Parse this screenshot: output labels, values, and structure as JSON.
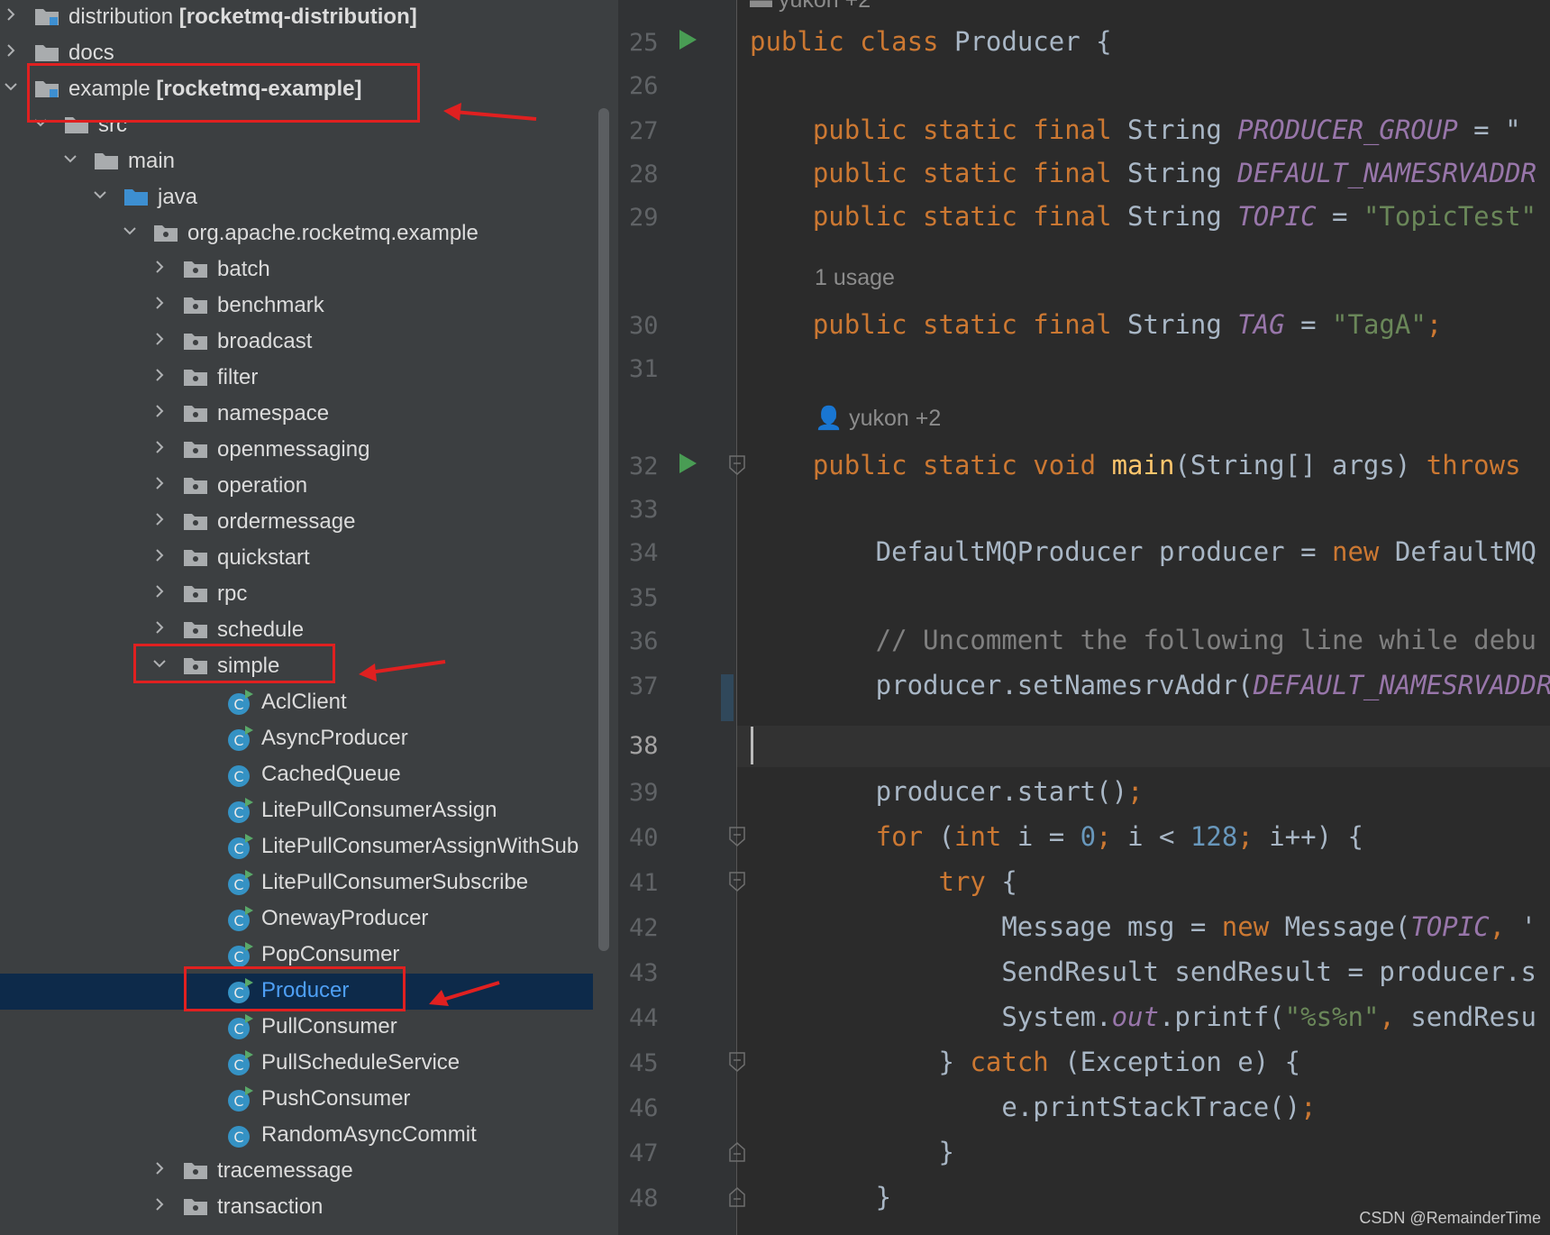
{
  "project_tree": {
    "items": [
      {
        "label": "distribution ",
        "module": "[rocketmq-distribution]",
        "type": "module",
        "expanded": false
      },
      {
        "label": "docs",
        "module": "",
        "type": "folder",
        "expanded": false
      },
      {
        "label": "example ",
        "module": "[rocketmq-example]",
        "type": "module",
        "expanded": true
      },
      {
        "label": "src",
        "module": "",
        "type": "folder",
        "expanded": true
      },
      {
        "label": "main",
        "module": "",
        "type": "folder",
        "expanded": true
      },
      {
        "label": "java",
        "module": "",
        "type": "source-folder",
        "expanded": true
      },
      {
        "label": "org.apache.rocketmq.example",
        "module": "",
        "type": "package",
        "expanded": true
      },
      {
        "label": "batch",
        "module": "",
        "type": "package",
        "expanded": false
      },
      {
        "label": "benchmark",
        "module": "",
        "type": "package",
        "expanded": false
      },
      {
        "label": "broadcast",
        "module": "",
        "type": "package",
        "expanded": false
      },
      {
        "label": "filter",
        "module": "",
        "type": "package",
        "expanded": false
      },
      {
        "label": "namespace",
        "module": "",
        "type": "package",
        "expanded": false
      },
      {
        "label": "openmessaging",
        "module": "",
        "type": "package",
        "expanded": false
      },
      {
        "label": "operation",
        "module": "",
        "type": "package",
        "expanded": false
      },
      {
        "label": "ordermessage",
        "module": "",
        "type": "package",
        "expanded": false
      },
      {
        "label": "quickstart",
        "module": "",
        "type": "package",
        "expanded": false
      },
      {
        "label": "rpc",
        "module": "",
        "type": "package",
        "expanded": false
      },
      {
        "label": "schedule",
        "module": "",
        "type": "package",
        "expanded": false
      },
      {
        "label": "simple",
        "module": "",
        "type": "package",
        "expanded": true
      },
      {
        "label": "AclClient",
        "module": "",
        "type": "class-runnable"
      },
      {
        "label": "AsyncProducer",
        "module": "",
        "type": "class-runnable"
      },
      {
        "label": "CachedQueue",
        "module": "",
        "type": "class"
      },
      {
        "label": "LitePullConsumerAssign",
        "module": "",
        "type": "class-runnable"
      },
      {
        "label": "LitePullConsumerAssignWithSub",
        "module": "",
        "type": "class-runnable"
      },
      {
        "label": "LitePullConsumerSubscribe",
        "module": "",
        "type": "class-runnable"
      },
      {
        "label": "OnewayProducer",
        "module": "",
        "type": "class-runnable"
      },
      {
        "label": "PopConsumer",
        "module": "",
        "type": "class-runnable"
      },
      {
        "label": "Producer",
        "module": "",
        "type": "class-runnable",
        "selected": true
      },
      {
        "label": "PullConsumer",
        "module": "",
        "type": "class-runnable"
      },
      {
        "label": "PullScheduleService",
        "module": "",
        "type": "class-runnable"
      },
      {
        "label": "PushConsumer",
        "module": "",
        "type": "class-runnable"
      },
      {
        "label": "RandomAsyncCommit",
        "module": "",
        "type": "class"
      },
      {
        "label": "tracemessage",
        "module": "",
        "type": "package",
        "expanded": false
      },
      {
        "label": "transaction",
        "module": "",
        "type": "package",
        "expanded": false
      }
    ]
  },
  "editor": {
    "top_hint": "yukon +2",
    "current_line": "38",
    "usage_hint": "1 usage",
    "author_hint": "yukon +2",
    "lines": [
      {
        "n": "25",
        "tokens": [
          [
            "kw",
            "public class "
          ],
          [
            "",
            "Producer {"
          ]
        ]
      },
      {
        "n": "26",
        "tokens": []
      },
      {
        "n": "27",
        "tokens": [
          [
            "kw",
            "    public static final "
          ],
          [
            "",
            "String "
          ],
          [
            "cn",
            "PRODUCER_GROUP"
          ],
          [
            "",
            " = \""
          ]
        ]
      },
      {
        "n": "28",
        "tokens": [
          [
            "kw",
            "    public static final "
          ],
          [
            "",
            "String "
          ],
          [
            "cn",
            "DEFAULT_NAMESRVADDR"
          ]
        ]
      },
      {
        "n": "29",
        "tokens": [
          [
            "kw",
            "    public static final "
          ],
          [
            "",
            "String "
          ],
          [
            "cn",
            "TOPIC"
          ],
          [
            "",
            " = "
          ],
          [
            "str",
            "\"TopicTest\""
          ]
        ]
      },
      {
        "n": "30",
        "tokens": [
          [
            "kw",
            "    public static final "
          ],
          [
            "",
            "String "
          ],
          [
            "cn",
            "TAG"
          ],
          [
            "",
            " = "
          ],
          [
            "str",
            "\"TagA\""
          ],
          [
            "kw",
            ";"
          ]
        ]
      },
      {
        "n": "31",
        "tokens": []
      },
      {
        "n": "32",
        "tokens": [
          [
            "kw",
            "    public static void "
          ],
          [
            "fn",
            "main"
          ],
          [
            "",
            "(String[] args) "
          ],
          [
            "kw",
            "throws"
          ]
        ]
      },
      {
        "n": "33",
        "tokens": []
      },
      {
        "n": "34",
        "tokens": [
          [
            "",
            "        DefaultMQProducer producer = "
          ],
          [
            "kw",
            "new "
          ],
          [
            "",
            "DefaultMQ"
          ]
        ]
      },
      {
        "n": "35",
        "tokens": []
      },
      {
        "n": "36",
        "tokens": [
          [
            "cmt",
            "        // Uncomment the following line while debu"
          ]
        ]
      },
      {
        "n": "37",
        "tokens": [
          [
            "",
            "        producer.setNamesrvAddr("
          ],
          [
            "cn",
            "DEFAULT_NAMESRVADDR"
          ]
        ]
      },
      {
        "n": "38",
        "tokens": []
      },
      {
        "n": "39",
        "tokens": [
          [
            "",
            "        producer.start()"
          ],
          [
            "kw",
            ";"
          ]
        ]
      },
      {
        "n": "40",
        "tokens": [
          [
            "kw",
            "        for "
          ],
          [
            "",
            "("
          ],
          [
            "kw",
            "int "
          ],
          [
            "",
            "i = "
          ],
          [
            "num",
            "0"
          ],
          [
            "kw",
            "; "
          ],
          [
            "",
            "i < "
          ],
          [
            "num",
            "128"
          ],
          [
            "kw",
            "; "
          ],
          [
            "",
            "i++) {"
          ]
        ]
      },
      {
        "n": "41",
        "tokens": [
          [
            "kw",
            "            try "
          ],
          [
            "",
            "{"
          ]
        ]
      },
      {
        "n": "42",
        "tokens": [
          [
            "",
            "                Message msg = "
          ],
          [
            "kw",
            "new "
          ],
          [
            "",
            "Message("
          ],
          [
            "cn",
            "TOPIC"
          ],
          [
            "kw",
            ", "
          ],
          [
            "",
            "'"
          ]
        ]
      },
      {
        "n": "43",
        "tokens": [
          [
            "",
            "                SendResult sendResult = producer.s"
          ]
        ]
      },
      {
        "n": "44",
        "tokens": [
          [
            "",
            "                System."
          ],
          [
            "cn",
            "out"
          ],
          [
            "",
            ".printf("
          ],
          [
            "str",
            "\"%s%n\""
          ],
          [
            "kw",
            ", "
          ],
          [
            "",
            "sendResu"
          ]
        ]
      },
      {
        "n": "45",
        "tokens": [
          [
            "",
            "            } "
          ],
          [
            "kw",
            "catch "
          ],
          [
            "",
            "(Exception e) {"
          ]
        ]
      },
      {
        "n": "46",
        "tokens": [
          [
            "",
            "                e.printStackTrace()"
          ],
          [
            "kw",
            ";"
          ]
        ]
      },
      {
        "n": "47",
        "tokens": [
          [
            "",
            "            }"
          ]
        ]
      },
      {
        "n": "48",
        "tokens": [
          [
            "",
            "        }"
          ]
        ]
      }
    ]
  },
  "watermark": "CSDN @RemainderTime",
  "colors": {
    "panel_bg": "#3c3f41",
    "editor_bg": "#2b2b2b",
    "selection": "#0d2a4a",
    "keyword": "#cc7832",
    "constant": "#9876aa",
    "string": "#6a8759",
    "number": "#6897bb",
    "function": "#ffc66d",
    "annotation_red": "#e02020"
  }
}
